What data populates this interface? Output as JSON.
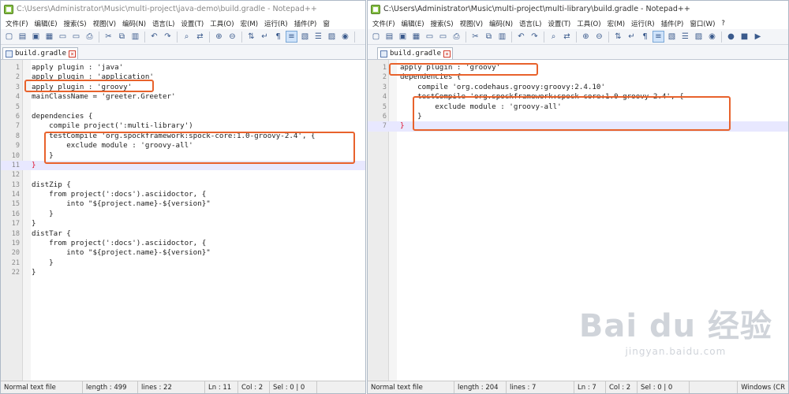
{
  "left_window": {
    "title": "C:\\Users\\Administrator\\Music\\multi-project\\java-demo\\build.gradle - Notepad++",
    "menu": [
      "文件(F)",
      "编辑(E)",
      "搜索(S)",
      "视图(V)",
      "编码(N)",
      "语言(L)",
      "设置(T)",
      "工具(O)",
      "宏(M)",
      "运行(R)",
      "插件(P)",
      "窗"
    ],
    "tab_label": "build.gradle",
    "lines": [
      {
        "n": "1",
        "text": "apply plugin : 'java'"
      },
      {
        "n": "2",
        "text": "apply plugin : 'application'"
      },
      {
        "n": "3",
        "text": "apply plugin : 'groovy'"
      },
      {
        "n": "4",
        "text": "mainClassName = 'greeter.Greeter'"
      },
      {
        "n": "5",
        "text": ""
      },
      {
        "n": "6",
        "text": "dependencies {"
      },
      {
        "n": "7",
        "text": "    compile project(':multi-library')"
      },
      {
        "n": "8",
        "text": "    testCompile 'org.spockframework:spock-core:1.0-groovy-2.4', {"
      },
      {
        "n": "9",
        "text": "        exclude module : 'groovy-all'"
      },
      {
        "n": "10",
        "text": "    }"
      },
      {
        "n": "11",
        "text": "}"
      },
      {
        "n": "12",
        "text": ""
      },
      {
        "n": "13",
        "text": "distZip {"
      },
      {
        "n": "14",
        "text": "    from project(':docs').asciidoctor, {"
      },
      {
        "n": "15",
        "text": "        into \"${project.name}-${version}\""
      },
      {
        "n": "16",
        "text": "    }"
      },
      {
        "n": "17",
        "text": "}"
      },
      {
        "n": "18",
        "text": "distTar {"
      },
      {
        "n": "19",
        "text": "    from project(':docs').asciidoctor, {"
      },
      {
        "n": "20",
        "text": "        into \"${project.name}-${version}\""
      },
      {
        "n": "21",
        "text": "    }"
      },
      {
        "n": "22",
        "text": "}"
      }
    ],
    "status": {
      "type": "Normal text file",
      "length": "length : 499",
      "lines": "lines : 22",
      "ln": "Ln : 11",
      "col": "Col : 2",
      "sel": "Sel : 0 | 0"
    }
  },
  "right_window": {
    "title": "C:\\Users\\Administrator\\Music\\multi-project\\multi-library\\build.gradle - Notepad++",
    "menu": [
      "文件(F)",
      "编辑(E)",
      "搜索(S)",
      "视图(V)",
      "编码(N)",
      "语言(L)",
      "设置(T)",
      "工具(O)",
      "宏(M)",
      "运行(R)",
      "插件(P)",
      "窗口(W)",
      "?"
    ],
    "tab_label": "build.gradle",
    "lines": [
      {
        "n": "1",
        "text": "apply plugin : 'groovy'"
      },
      {
        "n": "2",
        "text": "dependencies {"
      },
      {
        "n": "3",
        "text": "    compile 'org.codehaus.groovy:groovy:2.4.10'"
      },
      {
        "n": "4",
        "text": "    testCompile 'org.spockframework:spock-core:1.0-groovy-2.4', {"
      },
      {
        "n": "5",
        "text": "        exclude module : 'groovy-all'"
      },
      {
        "n": "6",
        "text": "    }"
      },
      {
        "n": "7",
        "text": "}"
      }
    ],
    "status": {
      "type": "Normal text file",
      "length": "length : 204",
      "lines": "lines : 7",
      "ln": "Ln : 7",
      "col": "Col : 2",
      "sel": "Sel : 0 | 0",
      "eol": "Windows (CR"
    }
  },
  "watermark": {
    "main": "Bai du 经验",
    "sub": "jingyan.baidu.com"
  },
  "colors": {
    "highlight_box": "#e8622c",
    "current_line": "#e8e8ff",
    "brace_match": "#e0112b"
  }
}
